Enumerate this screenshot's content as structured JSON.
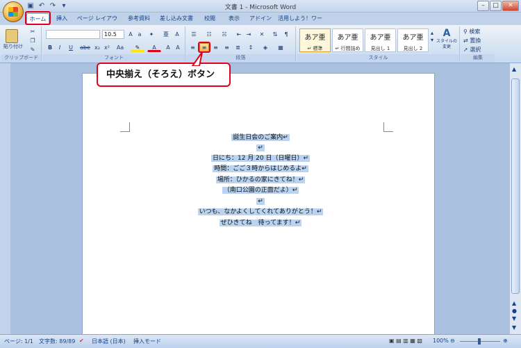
{
  "window": {
    "title": "文書 1 - Microsoft Word"
  },
  "tabs": [
    "ホーム",
    "挿入",
    "ページ レイアウト",
    "参考資料",
    "差し込み文書",
    "校閲",
    "表示",
    "アドイン",
    "活用しよう！ワード"
  ],
  "ribbon": {
    "clipboard": {
      "paste_label": "貼り付け",
      "group_label": "クリップボード"
    },
    "font": {
      "size": "10.5",
      "group_label": "フォント"
    },
    "paragraph": {
      "group_label": "段落"
    },
    "styles": {
      "group_label": "スタイル",
      "tiles": [
        {
          "sample": "あア亜",
          "name": "↵ 標準"
        },
        {
          "sample": "あア亜",
          "name": "↵ 行間詰め"
        },
        {
          "sample": "あア亜",
          "name": "見出し 1"
        },
        {
          "sample": "あア亜",
          "name": "見出し 2"
        }
      ],
      "change_styles": "スタイルの変更"
    },
    "editing": {
      "group_label": "編集",
      "find": "検索",
      "replace": "置換",
      "select": "選択"
    }
  },
  "callout": {
    "text": "中央揃え（そろえ）ボタン"
  },
  "document": {
    "lines": [
      "誕生日会のご案内↵",
      "↵",
      "日にち：12 月 20 日（日曜日）↵",
      "時間：ごご３時からはじめるよ↵",
      "場所：ひかるの家にきてね！↵",
      "（南口公園の正面だよ）↵",
      "↵",
      "いつも、なかよくしてくれてありがとう！↵",
      "ぜひきてね　待ってます！↵"
    ]
  },
  "status": {
    "page": "ページ: 1/1",
    "words": "文字数: 89/89",
    "language": "日本語 (日本)",
    "mode": "挿入モード",
    "zoom": "100%"
  }
}
